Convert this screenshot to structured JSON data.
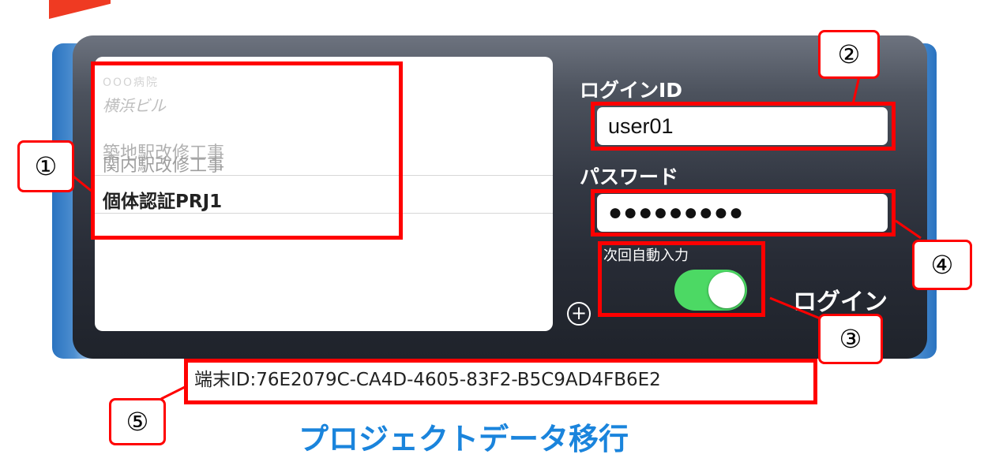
{
  "project_list": {
    "items": [
      {
        "label": "OOO病院",
        "state": "faded"
      },
      {
        "label": "横浜ビル",
        "state": "faded"
      },
      {
        "label": "築地駅改修工事",
        "state": "normal"
      },
      {
        "label": "関内駅改修工事",
        "state": "normal"
      },
      {
        "label": "個体認証PRJ1",
        "state": "selected"
      }
    ]
  },
  "login_form": {
    "login_id_label": "ログインID",
    "login_id_value": "user01",
    "password_label": "パスワード",
    "password_value": "●●●●●●●●●",
    "auto_input_label": "次回自動入力",
    "auto_input_on": true,
    "add_symbol": "+",
    "login_button": "ログイン"
  },
  "footer": {
    "device_id": "端末ID:76E2079C-CA4D-4605-83F2-B5C9AD4FB6E2",
    "migrate_link": "プロジェクトデータ移行"
  },
  "callouts": [
    "①",
    "②",
    "③",
    "④",
    "⑤"
  ],
  "colors": {
    "highlight": "#ff0000",
    "toggle_on": "#4cd964",
    "link": "#1a84dc",
    "brand_accent": "#ef3a22",
    "panel_dark": "#272b35"
  }
}
